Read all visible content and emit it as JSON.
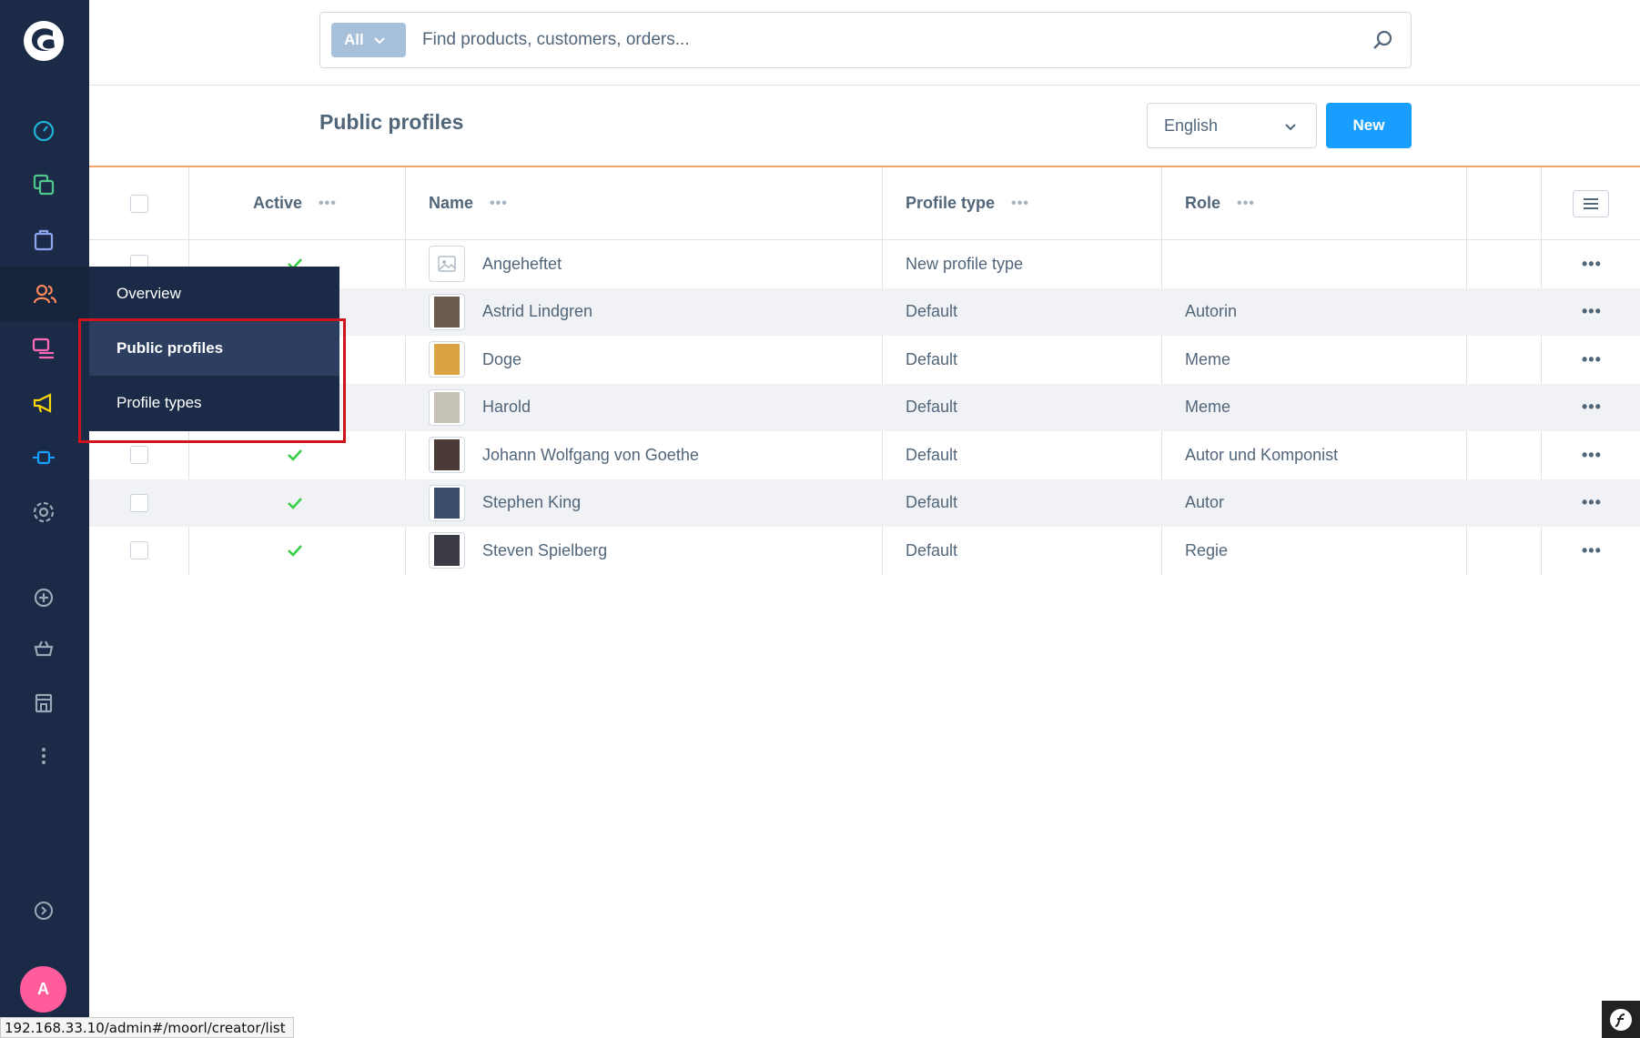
{
  "search": {
    "type_label": "All",
    "placeholder": "Find products, customers, orders..."
  },
  "page": {
    "title": "Public profiles",
    "language": "English",
    "new_button": "New"
  },
  "table": {
    "columns": {
      "active": "Active",
      "name": "Name",
      "profile_type": "Profile type",
      "role": "Role"
    },
    "rows": [
      {
        "name": "Angeheftet",
        "profile_type": "New profile type",
        "role": "",
        "active": true
      },
      {
        "name": "Astrid Lindgren",
        "profile_type": "Default",
        "role": "Autorin",
        "active": true
      },
      {
        "name": "Doge",
        "profile_type": "Default",
        "role": "Meme",
        "active": true
      },
      {
        "name": "Harold",
        "profile_type": "Default",
        "role": "Meme",
        "active": true
      },
      {
        "name": "Johann Wolfgang von Goethe",
        "profile_type": "Default",
        "role": "Autor und Komponist",
        "active": true
      },
      {
        "name": "Stephen King",
        "profile_type": "Default",
        "role": "Autor",
        "active": true
      },
      {
        "name": "Steven Spielberg",
        "profile_type": "Default",
        "role": "Regie",
        "active": true
      }
    ]
  },
  "flyout": {
    "items": [
      "Overview",
      "Public profiles",
      "Profile types"
    ]
  },
  "user": {
    "initial": "A"
  },
  "statusbar": {
    "url": "192.168.33.10/admin#/moorl/creator/list"
  },
  "colors": {
    "sidebar": "#1b2b47",
    "accent": "#189eff",
    "header_line": "#f6a46d",
    "highlight": "#d0141c",
    "avatar": "#ff5c9b",
    "check": "#37d046"
  }
}
